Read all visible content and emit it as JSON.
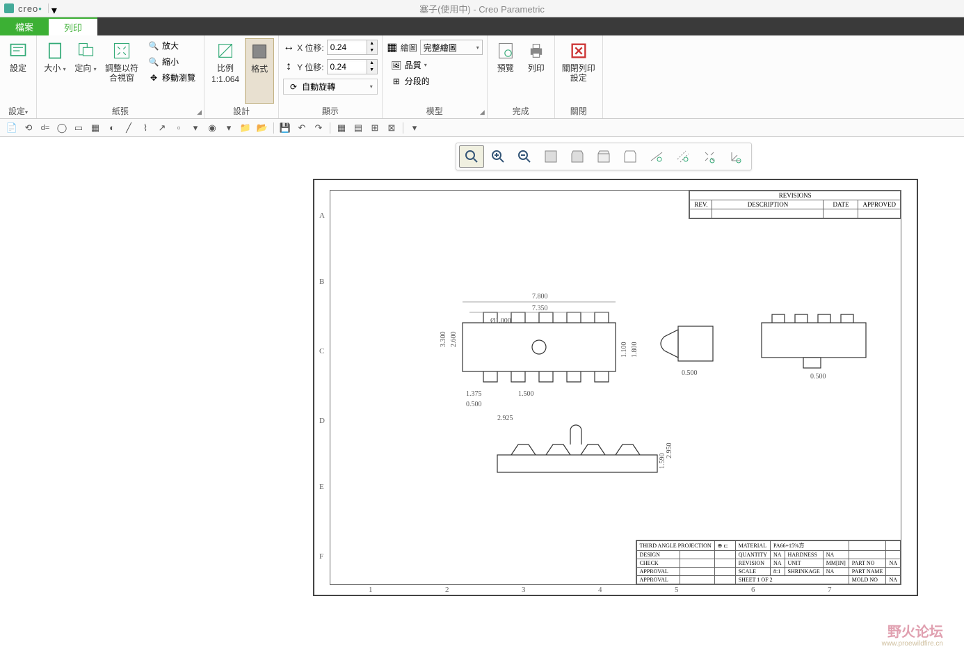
{
  "app": {
    "brand": "creo",
    "title": "塞子(使用中) - Creo Parametric"
  },
  "tabs": {
    "file": "檔案",
    "print": "列印"
  },
  "ribbon": {
    "g1": {
      "label": "設定",
      "settings": "設定",
      "settings_drop": "設定"
    },
    "g2": {
      "label": "紙張",
      "size": "大小",
      "orient": "定向",
      "fit": "調整以符\n合視窗",
      "zoomin": "放大",
      "zoomout": "縮小",
      "pan": "移動瀏覽"
    },
    "g3": {
      "label": "設計",
      "scale_lbl": "比例",
      "scale_val": "1:1.064",
      "format": "格式"
    },
    "g4": {
      "label": "顯示",
      "x_offset": "X 位移:",
      "y_offset": "Y 位移:",
      "x_val": "0.24",
      "y_val": "0.24",
      "autorotate": "自動旋轉"
    },
    "g5": {
      "label": "模型",
      "draw": "繪圖",
      "draw_opt": "完整繪圖",
      "quality": "品質",
      "segment": "分段的"
    },
    "g6": {
      "label": "完成",
      "preview": "預覽",
      "print": "列印"
    },
    "g7": {
      "label": "關閉",
      "close": "關閉列印\n設定"
    }
  },
  "drawing": {
    "rev": {
      "title": "REVISIONS",
      "h1": "REV.",
      "h2": "DESCRIPTION",
      "h3": "DATE",
      "h4": "APPROVED"
    },
    "zones_v": [
      "A",
      "B",
      "C",
      "D",
      "E",
      "F"
    ],
    "zones_h": [
      "1",
      "2",
      "3",
      "4",
      "5",
      "6",
      "7"
    ],
    "dims": {
      "d1": "7.800",
      "d2": "7.350",
      "d3": "Ø1.000",
      "d4": "3.300",
      "d5": "2.600",
      "d6": "1.100",
      "d7": "1.800",
      "d8": "1.375",
      "d9": "1.500",
      "d10": "0.500",
      "d11": "2.925",
      "d12": "0.500",
      "d13": "0.500",
      "d14": "2.950",
      "d15": "1.590"
    },
    "tblock": {
      "proj": "THIRD ANGLE PROJECTION",
      "mat": "MATERIAL",
      "mat_v": "PA66+15%方",
      "design": "DESIGN",
      "qty": "QUANTITY",
      "qty_v": "NA",
      "hard": "HARDNESS",
      "hard_v": "NA",
      "check": "CHECK",
      "rev": "REVISION",
      "rev_v": "NA",
      "unit": "UNIT",
      "unit_v": "MM[IN]",
      "partno": "PART NO",
      "partno_v": "NA",
      "appr": "APPROVAL",
      "scale": "SCALE",
      "scale_v": "8:1",
      "shrink": "SHRINKAGE",
      "shrink_v": "NA",
      "partname": "PART NAME",
      "sheet": "SHEET 1 OF 2",
      "mold": "MOLD NO",
      "mold_v": "NA"
    }
  },
  "wm": {
    "main": "野火论坛",
    "sub": "www.proewildfire.cn"
  }
}
